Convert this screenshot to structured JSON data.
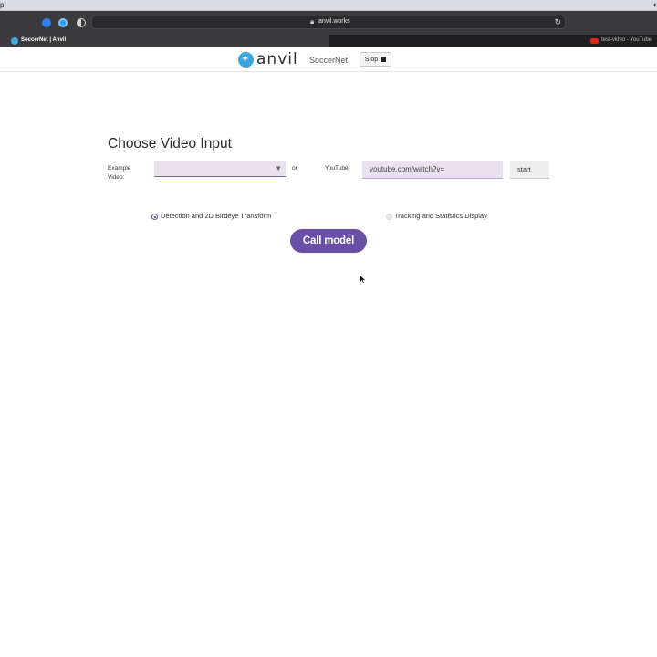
{
  "browser": {
    "url": "anvil.works",
    "tabs": [
      {
        "label": "SoccerNet | Anvil",
        "active": true
      },
      {
        "label": "test-video - YouTube",
        "active": false
      }
    ]
  },
  "header": {
    "logo_text": "anvil",
    "app_name": "SoccerNet",
    "stop_label": "Stop"
  },
  "main": {
    "title": "Choose Video Input",
    "example_label": "Example Video:",
    "example_selected": "",
    "or_label": "or",
    "youtube_label": "YouTube",
    "youtube_placeholder": "youtube.com/watch?v=",
    "start_label": "start",
    "radio_options": [
      {
        "label": "Detection and 2D Birdeye Transform",
        "selected": true
      },
      {
        "label": "Tracking and Statistics Display",
        "selected": false
      }
    ],
    "call_label": "Call model"
  },
  "colors": {
    "accent": "#6a4fa6",
    "input_bg": "#e9e1f0",
    "logo": "#3aa6dd"
  }
}
